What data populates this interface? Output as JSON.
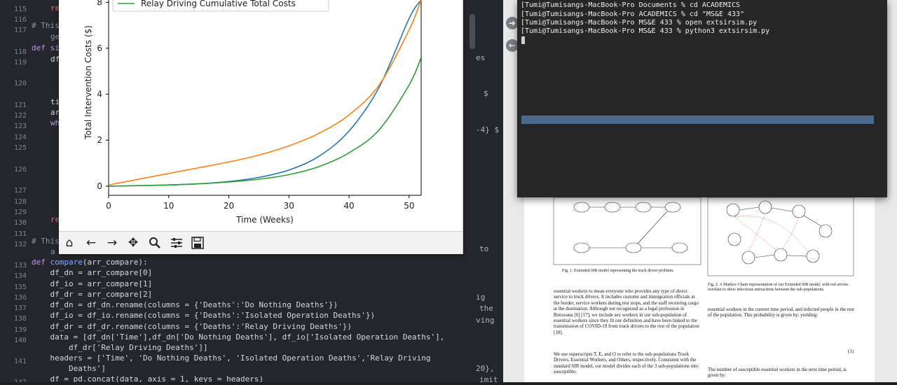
{
  "editor": {
    "line_numbers": [
      "115",
      "116",
      "117",
      "118",
      "119",
      "120",
      "121",
      "122",
      "123",
      "124",
      "125",
      "126",
      "127",
      "128",
      "129",
      "130",
      "131",
      "132",
      "133",
      "134",
      "135",
      "136",
      "137",
      "138",
      "139",
      "140",
      "141",
      "142"
    ],
    "partial_lines": {
      "l115": "re",
      "l117": "# This",
      "l117b": "ge",
      "l118": "def si",
      "l119": "df",
      "l121": "ti",
      "l122": "ar",
      "l123": "wh",
      "l130": "re",
      "l132": "# This",
      "l132b": "a"
    },
    "code": [
      "def compare(arr_compare):",
      "    df_dn = arr_compare[0]",
      "    df_io = arr_compare[1]",
      "    df_dr = arr_compare[2]",
      "    df_dn = df_dn.rename(columns = {'Deaths':'Do Nothing Deaths'})",
      "    df_io = df_io.rename(columns = {'Deaths':'Isolated Operation Deaths'})",
      "    df_dr = df_dr.rename(columns = {'Deaths':'Relay Driving Deaths'})",
      "    data = [df_dn['Time'],df_dn['Do Nothing Deaths'], df_io['Isolated Operation Deaths'],",
      "        df_dr['Relay Driving Deaths']]",
      "    headers = ['Time', 'Do Nothing Deaths', 'Isolated Operation Deaths','Relay Driving",
      "        Deaths']",
      "    df = pd.concat(data, axis = 1, keys = headers)"
    ],
    "stray": [
      "es",
      "$",
      "-4} $",
      "to",
      "ig",
      "the",
      "ving",
      "20},",
      "imit"
    ]
  },
  "figure": {
    "legend_label": "Relay Driving Cumulative Total Costs",
    "toolbar_icons": [
      "home-icon",
      "back-arrow-icon",
      "forward-arrow-icon",
      "pan-icon",
      "zoom-icon",
      "configure-icon",
      "save-icon"
    ]
  },
  "chart_data": {
    "type": "line",
    "title": "",
    "xlabel": "Time (Weeks)",
    "ylabel": "Total Intervention Costs ($)",
    "xlim": [
      0,
      52
    ],
    "ylim": [
      -0.4,
      8.1
    ],
    "xticks": [
      "0",
      "10",
      "20",
      "30",
      "40",
      "50"
    ],
    "yticks": [
      "0",
      "2",
      "4",
      "6",
      "8"
    ],
    "grid": false,
    "legend_position": "top-left",
    "series": [
      {
        "name": "",
        "color": "#1f77b4",
        "x": [
          0,
          5,
          10,
          15,
          20,
          25,
          30,
          35,
          40,
          45,
          50,
          52
        ],
        "y": [
          0,
          0.02,
          0.05,
          0.1,
          0.2,
          0.38,
          0.7,
          1.3,
          2.4,
          4.3,
          7.3,
          8.1
        ]
      },
      {
        "name": "",
        "color": "#ff7f0e",
        "x": [
          0,
          5,
          10,
          15,
          20,
          25,
          30,
          35,
          40,
          45,
          50,
          52
        ],
        "y": [
          0.05,
          0.3,
          0.55,
          0.8,
          1.05,
          1.35,
          1.75,
          2.3,
          3.1,
          4.4,
          6.8,
          8.1
        ]
      },
      {
        "name": "Relay Driving Cumulative Total Costs",
        "color": "#2ca02c",
        "x": [
          0,
          5,
          10,
          15,
          20,
          25,
          30,
          35,
          40,
          45,
          50,
          52
        ],
        "y": [
          0,
          0.02,
          0.05,
          0.1,
          0.18,
          0.3,
          0.5,
          0.85,
          1.45,
          2.45,
          4.4,
          5.6
        ]
      }
    ]
  },
  "terminal": {
    "lines": [
      "[Tumi@Tumisangs-MacBook-Pro Documents % cd ACADEMICS",
      "[Tumi@Tumisangs-MacBook-Pro ACADEMICS % cd \"MS&E 433\"",
      "[Tumi@Tumisangs-MacBook-Pro MS&E 433 % open extsirsim.py",
      "[Tumi@Tumisangs-MacBook-Pro MS&E 433 % python3 extsirsim.py"
    ]
  },
  "pdf": {
    "fig1_caption": "Fig. 1.  Extended SIR model representing the truck driver problem.",
    "fig2_caption": "Fig. 2.  A Markov Chain representation of our Extended SIR model, with red arrows overlain to show infectious interactions between the sub-populations.",
    "left_col": "essential workers to mean everyone who provides any type of direct service to truck drivers. It includes customs and immigration officials at the border, service workers during rest stops, and the staff receiving cargo at the destination. Although not recognized as a legal profession in Botswana [6] [17], we include sex workers in our sub-population of essential workers since they fit our definition and have been linked to the transmission of COVID-19 from truck drivers to the rest of the population [18].",
    "left_col2": "We use superscripts T, E, and O to refer to the sub-populations Truck Drivers, Essential Workers, and Others, respectively. Consistent with the standard SIR model, our model divides each of the 3 sub-populations into susceptible,",
    "right_col": "essential workers in the current time period, and infected people in the rest of the population. This probability is given by: yielding:",
    "equation_number": "(1)",
    "right_col2": "The number of susceptible essential workers in the next time period, is given by:"
  }
}
